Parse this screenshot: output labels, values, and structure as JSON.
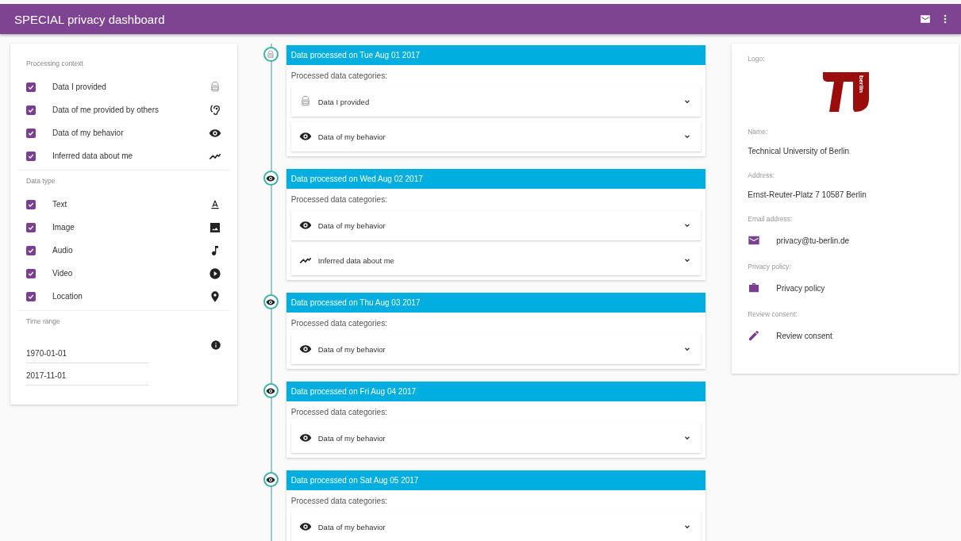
{
  "app_bar": {
    "title": "SPECIAL privacy dashboard"
  },
  "filters": {
    "sections": [
      {
        "heading": "Processing context",
        "items": [
          {
            "label": "Data I provided",
            "checked": true,
            "kind": "provided"
          },
          {
            "label": "Data of me provided by others",
            "checked": true,
            "kind": "others"
          },
          {
            "label": "Data of my behavior",
            "checked": true,
            "kind": "behavior"
          },
          {
            "label": "Inferred data about me",
            "checked": true,
            "kind": "inferred"
          }
        ]
      },
      {
        "heading": "Data type",
        "items": [
          {
            "label": "Text",
            "checked": true,
            "kind": "text"
          },
          {
            "label": "Image",
            "checked": true,
            "kind": "image"
          },
          {
            "label": "Audio",
            "checked": true,
            "kind": "audio"
          },
          {
            "label": "Video",
            "checked": true,
            "kind": "video"
          },
          {
            "label": "Location",
            "checked": true,
            "kind": "location"
          }
        ]
      }
    ],
    "time_range": {
      "heading": "Time range",
      "from": "1970-01-01",
      "to": "2017-11-01"
    }
  },
  "timeline": [
    {
      "title": "Data processed on Tue Aug 01 2017",
      "kind": "provided",
      "subtitle": "Processed data categories:",
      "categories": [
        {
          "label": "Data I provided",
          "kind": "provided"
        },
        {
          "label": "Data of my behavior",
          "kind": "behavior"
        }
      ]
    },
    {
      "title": "Data processed on Wed Aug 02 2017",
      "kind": "behavior",
      "subtitle": "Processed data categories:",
      "categories": [
        {
          "label": "Data of my behavior",
          "kind": "behavior"
        },
        {
          "label": "Inferred data about me",
          "kind": "inferred"
        }
      ]
    },
    {
      "title": "Data processed on Thu Aug 03 2017",
      "kind": "behavior",
      "subtitle": "Processed data categories:",
      "categories": [
        {
          "label": "Data of my behavior",
          "kind": "behavior"
        }
      ]
    },
    {
      "title": "Data processed on Fri Aug 04 2017",
      "kind": "behavior",
      "subtitle": "Processed data categories:",
      "categories": [
        {
          "label": "Data of my behavior",
          "kind": "behavior"
        }
      ]
    },
    {
      "title": "Data processed on Sat Aug 05 2017",
      "kind": "behavior",
      "subtitle": "Processed data categories:",
      "categories": [
        {
          "label": "Data of my behavior",
          "kind": "behavior"
        }
      ]
    }
  ],
  "controller": {
    "logo_label": "Logo:",
    "logo_text": "berlin",
    "fields": [
      {
        "label": "Name:",
        "value": "Technical University of Berlin",
        "kind": "text"
      },
      {
        "label": "Address:",
        "value": "Ernst-Reuter-Platz 7 10587 Berlin",
        "kind": "text"
      },
      {
        "label": "Email address:",
        "value": "privacy@tu-berlin.de",
        "kind": "email"
      },
      {
        "label": "Privacy policy:",
        "value": "Privacy policy",
        "kind": "policy"
      },
      {
        "label": "Review consent:",
        "value": "Review consent",
        "kind": "consent"
      }
    ]
  }
}
